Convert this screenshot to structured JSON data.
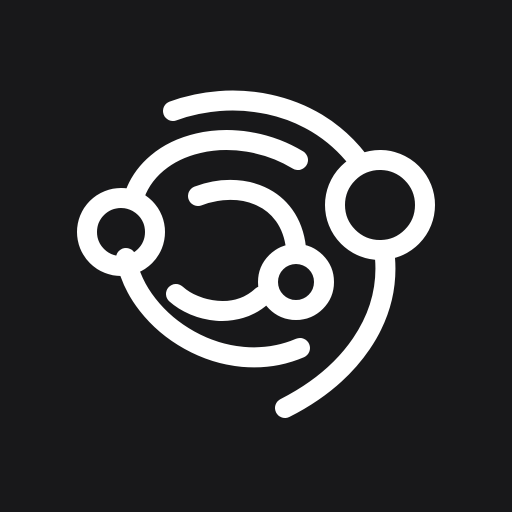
{
  "logo": {
    "icon_name": "orbit-planets-logo-icon",
    "background_color": "#18181a",
    "stroke_color": "#ffffff"
  }
}
